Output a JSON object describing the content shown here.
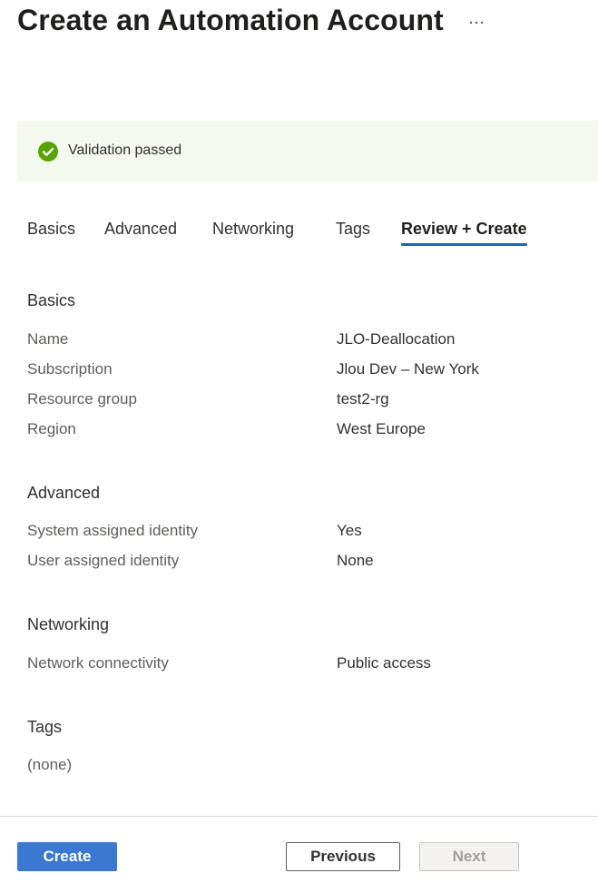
{
  "header": {
    "title": "Create an Automation Account",
    "more_icon": "ellipsis-icon",
    "more_label": "···"
  },
  "banner": {
    "icon": "check-circle-icon",
    "icon_color": "#57a300",
    "background_color": "#f3f9ec",
    "text": "Validation passed"
  },
  "tabs": [
    {
      "label": "Basics",
      "active": false
    },
    {
      "label": "Advanced",
      "active": false
    },
    {
      "label": "Networking",
      "active": false
    },
    {
      "label": "Tags",
      "active": false
    },
    {
      "label": "Review + Create",
      "active": true
    }
  ],
  "accent_color": "#0f6cbd",
  "sections": {
    "basics": {
      "title": "Basics",
      "rows": [
        {
          "label": "Name",
          "value": "JLO-Deallocation"
        },
        {
          "label": "Subscription",
          "value": "Jlou Dev – New York"
        },
        {
          "label": "Resource group",
          "value": "test2-rg"
        },
        {
          "label": "Region",
          "value": "West Europe"
        }
      ]
    },
    "advanced": {
      "title": "Advanced",
      "rows": [
        {
          "label": "System assigned identity",
          "value": "Yes"
        },
        {
          "label": "User assigned identity",
          "value": "None"
        }
      ]
    },
    "networking": {
      "title": "Networking",
      "rows": [
        {
          "label": "Network connectivity",
          "value": "Public access"
        }
      ]
    },
    "tags": {
      "title": "Tags",
      "empty_text": "(none)"
    }
  },
  "footer": {
    "create_label": "Create",
    "previous_label": "Previous",
    "next_label": "Next",
    "create_color": "#3a78d2"
  }
}
